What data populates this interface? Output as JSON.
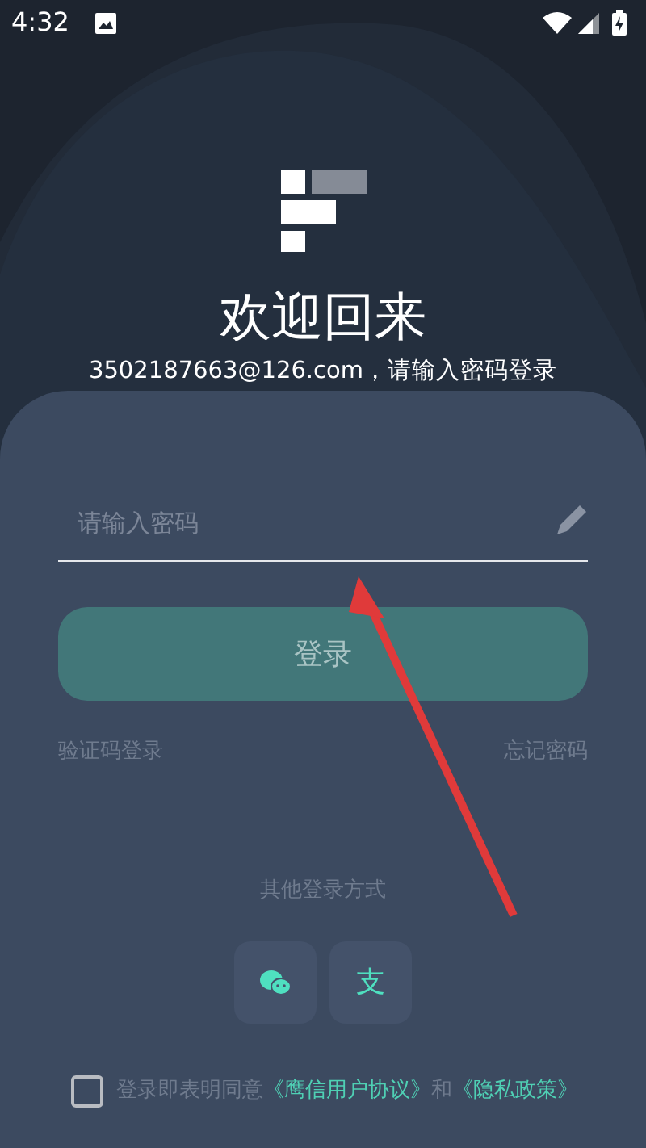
{
  "status_bar": {
    "time": "4:32"
  },
  "header": {
    "title": "欢迎回来",
    "subtitle": "3502187663@126.com，请输入密码登录"
  },
  "password_field": {
    "placeholder": "请输入密码"
  },
  "login_button": {
    "label": "登录",
    "disabled": true
  },
  "links": [
    {
      "label": "验证码登录"
    },
    {
      "label": "忘记密码"
    }
  ],
  "other_login": {
    "label": "其他登录方式",
    "options": [
      {
        "kind": "wechat"
      },
      {
        "kind": "alipay",
        "glyph": "支"
      }
    ]
  },
  "agreement": {
    "checked": false,
    "text": "登录即表明同意",
    "link_1": "《鹰信用户协议》",
    "joiner": "和",
    "link_2": "《隐私政策》"
  }
}
